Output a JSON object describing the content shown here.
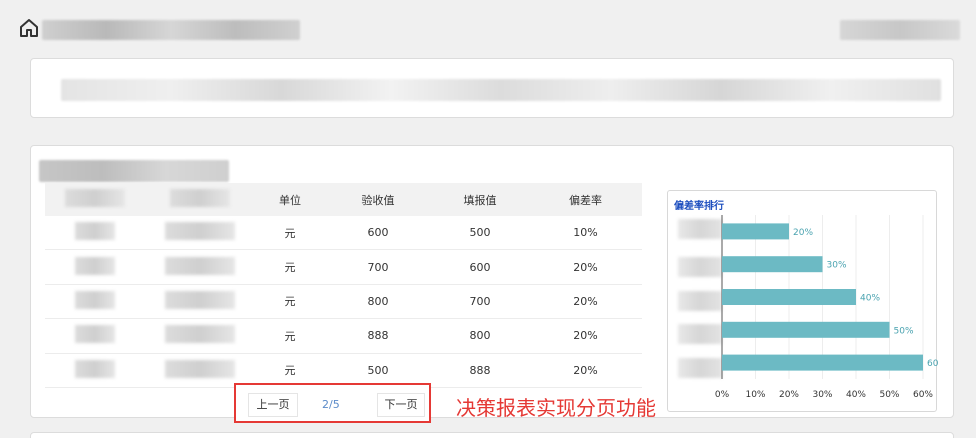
{
  "table": {
    "headers": [
      "单位",
      "验收值",
      "填报值",
      "偏差率"
    ],
    "rows": [
      {
        "unit": "元",
        "accepted": "600",
        "reported": "500",
        "deviation": "10%"
      },
      {
        "unit": "元",
        "accepted": "700",
        "reported": "600",
        "deviation": "20%"
      },
      {
        "unit": "元",
        "accepted": "800",
        "reported": "700",
        "deviation": "20%"
      },
      {
        "unit": "元",
        "accepted": "888",
        "reported": "800",
        "deviation": "20%"
      },
      {
        "unit": "元",
        "accepted": "500",
        "reported": "888",
        "deviation": "20%"
      }
    ]
  },
  "pager": {
    "prev_label": "上一页",
    "page_indicator": "2/5",
    "next_label": "下一页"
  },
  "annotation": "决策报表实现分页功能",
  "chart_data": {
    "type": "bar",
    "orientation": "horizontal",
    "title": "偏差率排行",
    "values": [
      20,
      30,
      40,
      50,
      60
    ],
    "value_labels": [
      "20%",
      "30%",
      "40%",
      "50%",
      "60"
    ],
    "xlim": [
      0,
      60
    ],
    "xticks": [
      "0%",
      "10%",
      "20%",
      "30%",
      "40%",
      "50%",
      "60%"
    ],
    "bar_color": "#6cbac4",
    "grid": true
  },
  "colors": {
    "accent_red": "#e53935",
    "bar": "#6cbac4",
    "chart_title": "#1e4fbf"
  }
}
